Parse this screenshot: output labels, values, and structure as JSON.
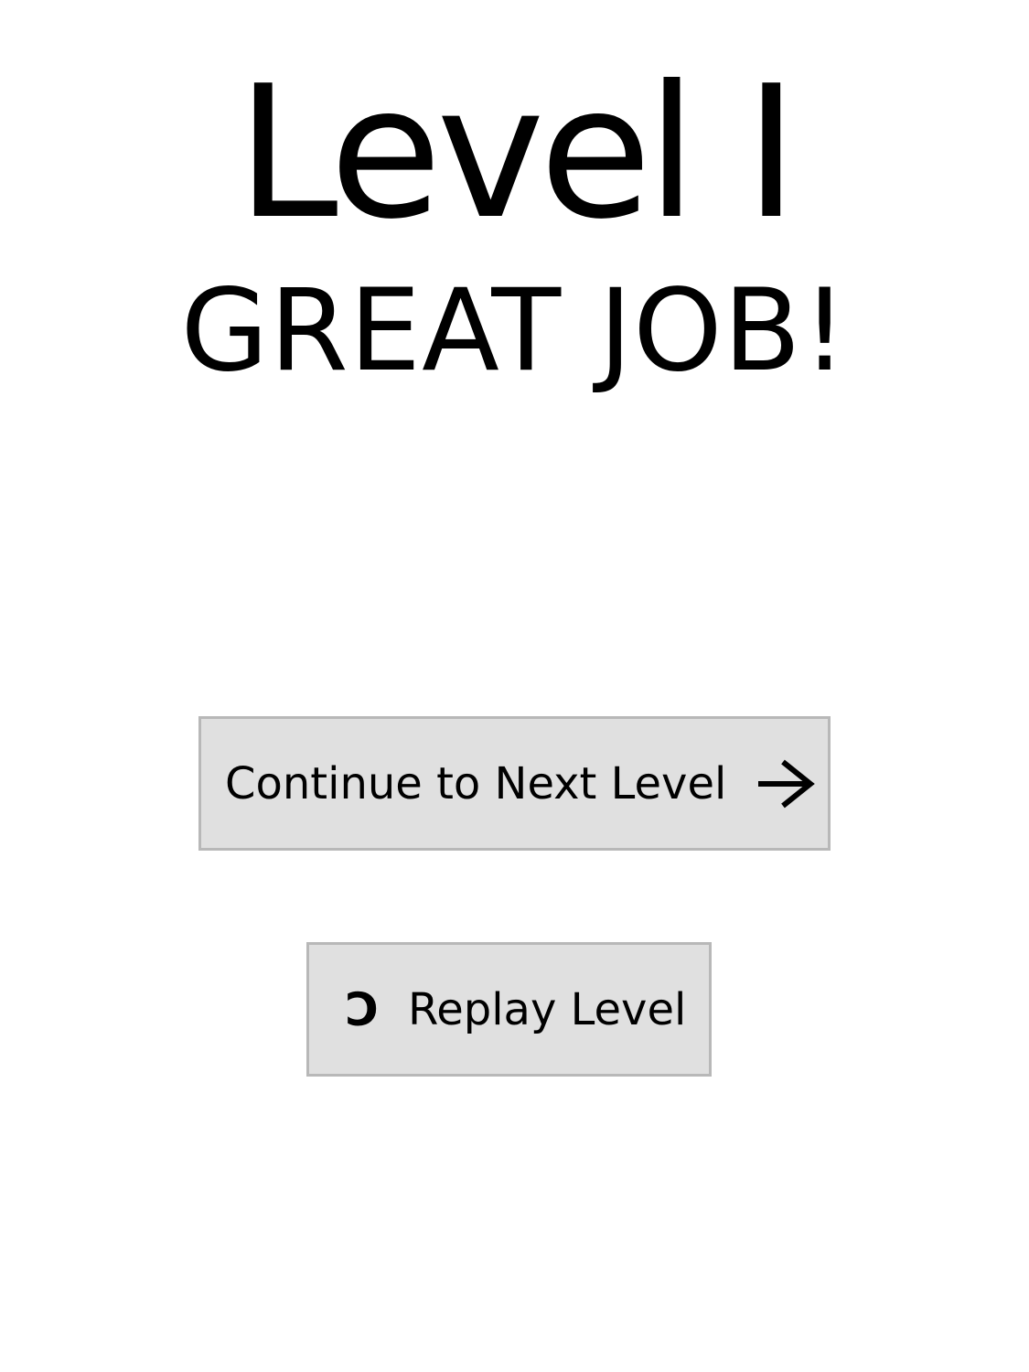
{
  "header": {
    "level_title": "Level I",
    "message": "GREAT JOB!"
  },
  "buttons": {
    "continue_label": "Continue to Next Level",
    "continue_icon": "arrow-right-icon",
    "replay_label": "Replay Level",
    "replay_icon": "replay-icon",
    "replay_glyph": "Ͻ"
  },
  "colors": {
    "background": "#ffffff",
    "button_fill": "#e0e0e0",
    "button_border": "#b8b8b8",
    "text": "#000000"
  }
}
